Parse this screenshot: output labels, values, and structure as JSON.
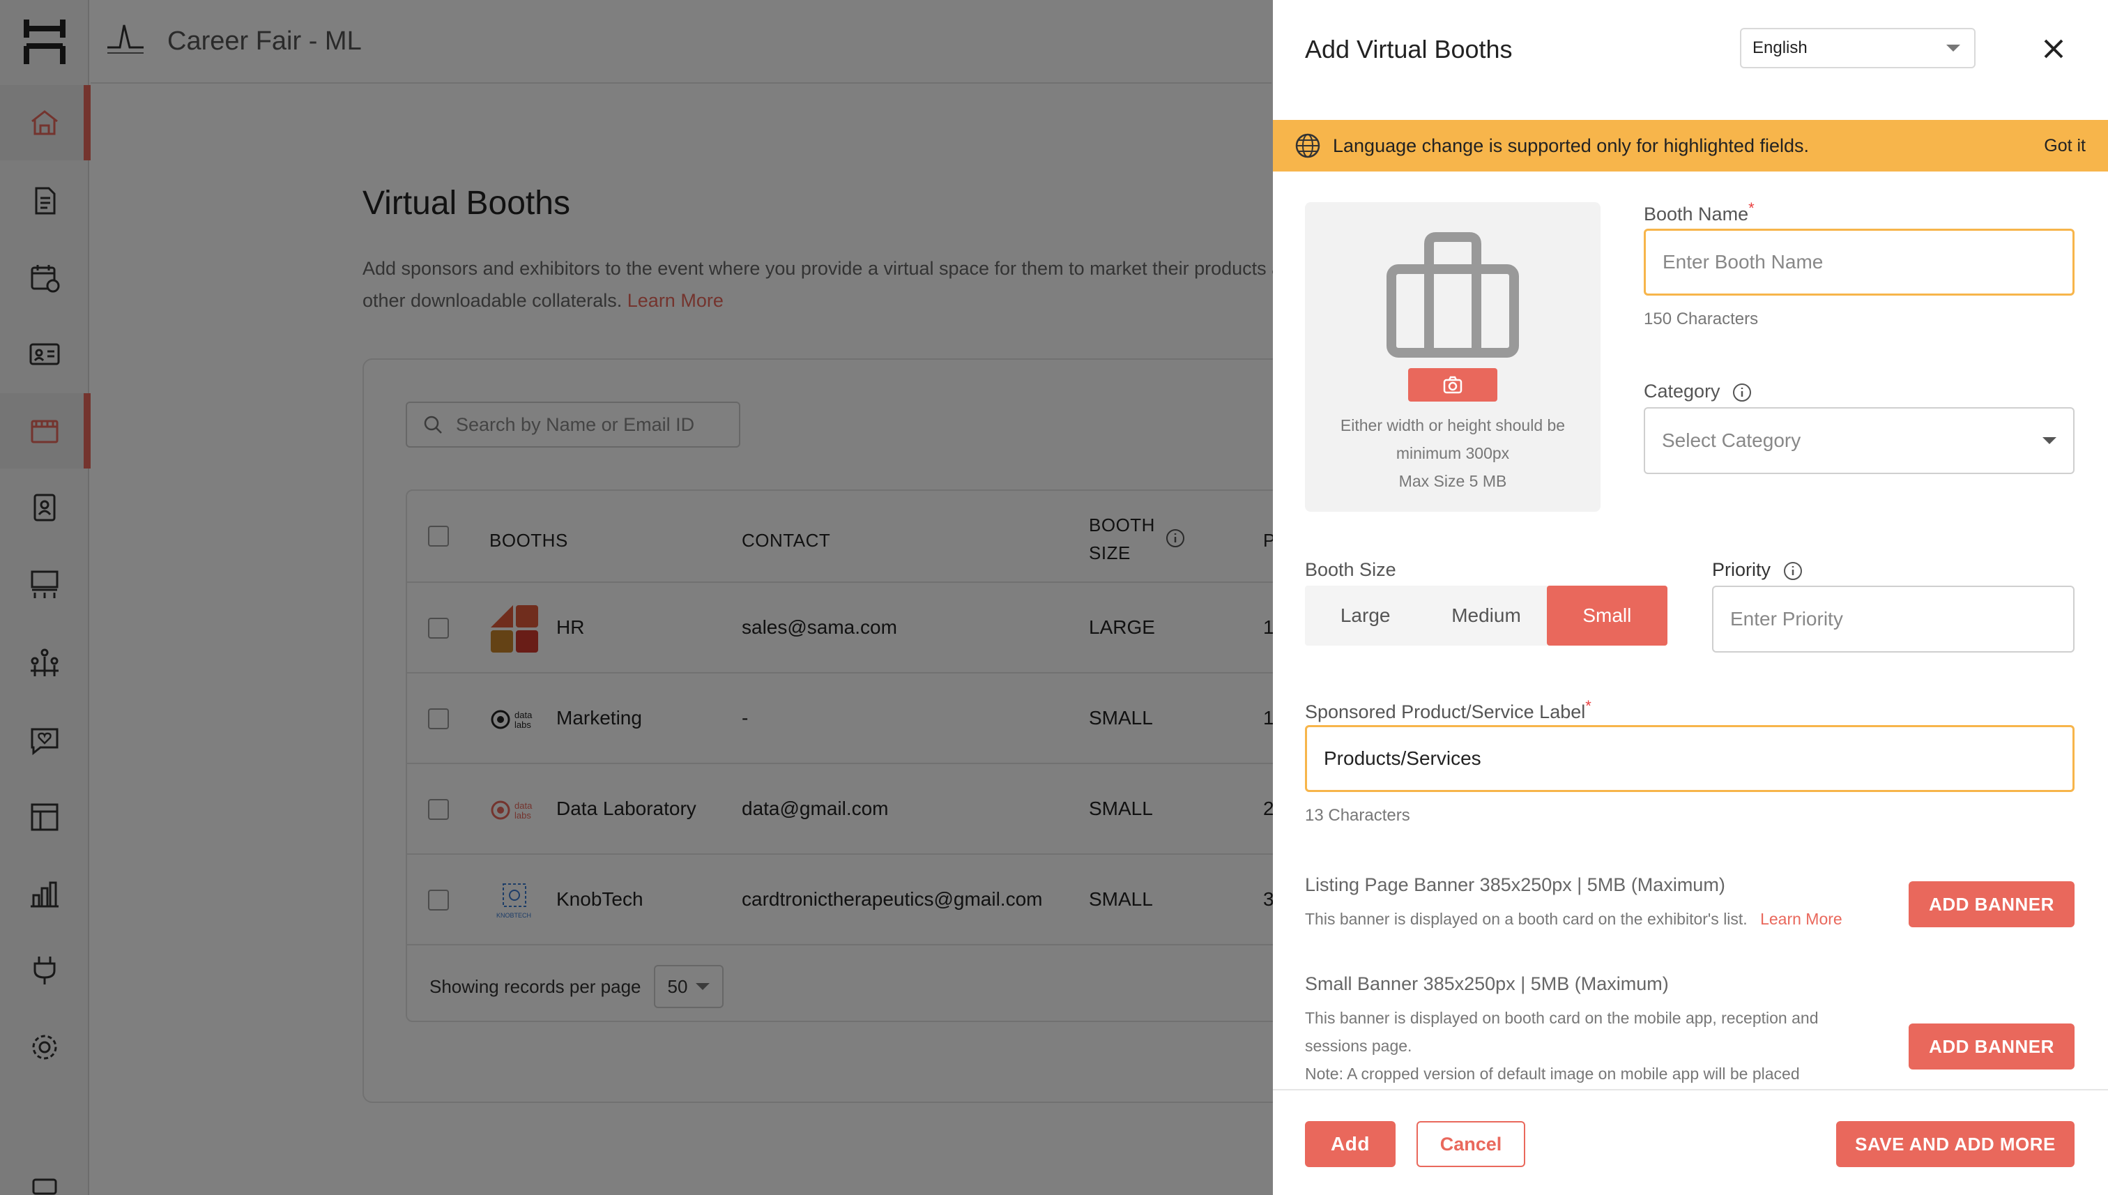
{
  "app": {
    "event_title": "Career Fair - ML"
  },
  "sidebar": {
    "icons": [
      "home-icon",
      "document-icon",
      "calendar-icon",
      "id-card-icon",
      "booth-icon",
      "badge-icon",
      "stage-icon",
      "networking-icon",
      "engagement-icon",
      "layout-icon",
      "analytics-icon",
      "integrations-icon",
      "settings-icon",
      "more-icon"
    ]
  },
  "page": {
    "title": "Virtual Booths",
    "description": "Add sponsors and exhibitors to the event where you provide a virtual space for them to market their products and other downloadable collaterals.",
    "learn_more": "Learn More",
    "search_placeholder": "Search by Name or Email ID",
    "columns": {
      "booths": "BOOTHS",
      "contact": "CONTACT",
      "booth_size_1": "BOOTH",
      "booth_size_2": "SIZE",
      "priority_partial": "P"
    },
    "rows": [
      {
        "name": "HR",
        "contact": "sales@sama.com",
        "size": "LARGE",
        "priority": "1"
      },
      {
        "name": "Marketing",
        "contact": "-",
        "size": "SMALL",
        "priority": "1"
      },
      {
        "name": "Data Laboratory",
        "contact": "data@gmail.com",
        "size": "SMALL",
        "priority": "2"
      },
      {
        "name": "KnobTech",
        "contact": "cardtronictherapeutics@gmail.com",
        "size": "SMALL",
        "priority": "3"
      }
    ],
    "pager_label": "Showing records per page",
    "pager_value": "50"
  },
  "drawer": {
    "title": "Add Virtual Booths",
    "language": "English",
    "banner_msg": "Language change is supported only for highlighted fields.",
    "banner_action": "Got it",
    "upload_note_1": "Either width or height should be",
    "upload_note_2": "minimum 300px",
    "upload_note_3": "Max Size 5 MB",
    "booth_name_label": "Booth Name",
    "booth_name_placeholder": "Enter Booth Name",
    "booth_name_hint": "150 Characters",
    "category_label": "Category",
    "category_placeholder": "Select Category",
    "booth_size_label": "Booth Size",
    "sizes": [
      "Large",
      "Medium",
      "Small"
    ],
    "selected_size": "Small",
    "priority_label": "Priority",
    "priority_placeholder": "Enter Priority",
    "sponsored_label": "Sponsored Product/Service Label",
    "sponsored_value": "Products/Services",
    "sponsored_hint": "13 Characters",
    "listing_title": "Listing Page Banner 385x250px | 5MB (Maximum)",
    "listing_desc": "This banner is displayed on a booth card on the exhibitor's list.",
    "listing_learn_more": "Learn More",
    "small_title": "Small Banner 385x250px | 5MB (Maximum)",
    "small_desc_1": "This banner is displayed on booth card on the mobile app, reception and",
    "small_desc_2": "sessions page.",
    "small_desc_3": "Note: A cropped version of default image on mobile app will be placed",
    "add_banner": "ADD BANNER",
    "btn_add": "Add",
    "btn_cancel": "Cancel",
    "btn_save_more": "SAVE AND ADD MORE"
  },
  "colors": {
    "accent": "#e9685c",
    "warning": "#f7b54b"
  }
}
